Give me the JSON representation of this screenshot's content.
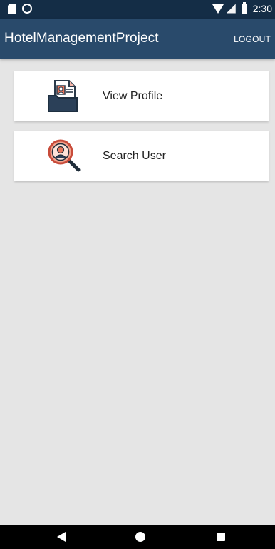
{
  "status_bar": {
    "time": "2:30",
    "icons": [
      "sd-card-icon",
      "circle-icon",
      "wifi-icon",
      "signal-icon",
      "battery-icon"
    ]
  },
  "app_bar": {
    "title": "HotelManagementProject",
    "logout_label": "LOGOUT",
    "background": "#294a6b"
  },
  "menu": {
    "items": [
      {
        "label": "View Profile",
        "icon": "profile-folder-icon"
      },
      {
        "label": "Search User",
        "icon": "search-user-icon"
      }
    ]
  },
  "nav_bar": {
    "icons": [
      "back-icon",
      "home-icon",
      "recents-icon"
    ]
  },
  "colors": {
    "status_bar": "#142d46",
    "background": "#e5e5e5",
    "card": "#ffffff"
  }
}
